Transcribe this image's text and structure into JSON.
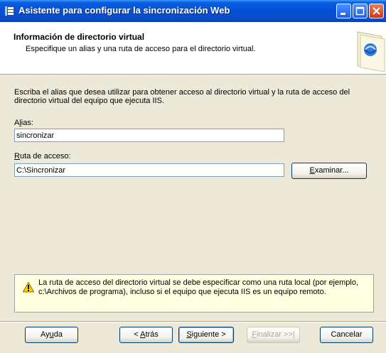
{
  "window": {
    "title": "Asistente para configurar la sincronización Web"
  },
  "header": {
    "title": "Información de directorio virtual",
    "subtitle": "Especifique un alias y una ruta de acceso para el directorio virtual."
  },
  "body": {
    "instructions": "Escriba el alias que desea utilizar para obtener acceso al directorio virtual y la ruta de acceso del directorio virtual del equipo que ejecuta IIS.",
    "alias": {
      "label_prefix": "A",
      "label_mnemonic": "l",
      "label_rest": "ias:",
      "value": "sincronizar"
    },
    "path": {
      "label_mnemonic": "R",
      "label_rest": "uta de acceso:",
      "value": "C:\\Sincronizar"
    },
    "browse": {
      "mnemonic": "E",
      "rest": "xaminar..."
    }
  },
  "warning": {
    "text": "La ruta de acceso del directorio virtual se debe especificar como una ruta local (por ejemplo, c:\\Archivos de programa), incluso si el equipo que ejecuta IIS es un equipo remoto."
  },
  "footer": {
    "help": {
      "prefix": "Ay",
      "mnemonic": "u",
      "rest": "da"
    },
    "back": {
      "prefix": "< ",
      "mnemonic": "A",
      "rest": "trás"
    },
    "next": {
      "mnemonic": "S",
      "rest": "iguiente >"
    },
    "finish": {
      "mnemonic": "F",
      "rest": "inalizar >>|"
    },
    "cancel": "Cancelar"
  },
  "colors": {
    "titlebar": "#0550d6",
    "dialog_background": "#ece9d8",
    "warning_background": "#ffffe1"
  },
  "icons": [
    "wizard-app-icon",
    "minimize-icon",
    "maximize-icon",
    "close-icon",
    "header-book-icon",
    "warning-icon"
  ]
}
